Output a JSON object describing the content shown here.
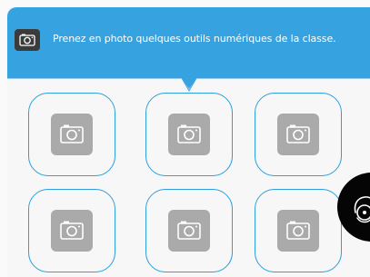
{
  "banner": {
    "instruction": "Prenez en photo quelques outils numériques de la classe.",
    "icon": "camera-icon",
    "color": "#37a2e0"
  },
  "photo_slots": {
    "count": 6,
    "icon": "camera-placeholder-icon",
    "border_color": "#2c9fdc"
  },
  "floating_button": {
    "icon": "voice-assistant-icon"
  }
}
